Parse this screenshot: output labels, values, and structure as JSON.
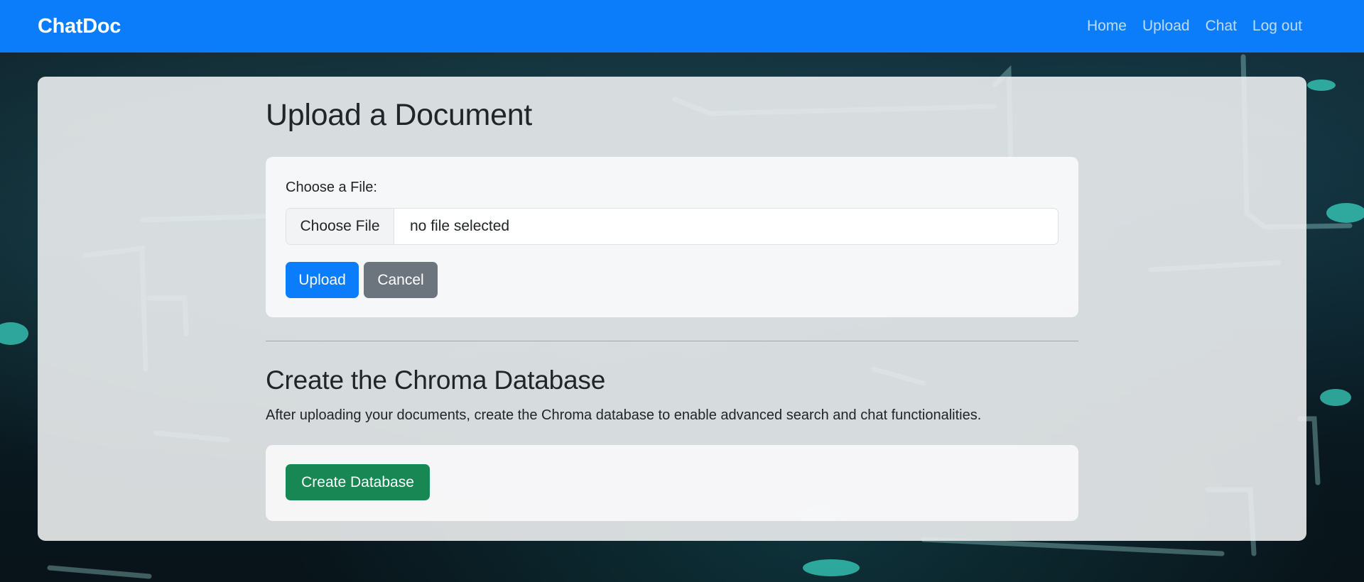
{
  "navbar": {
    "brand": "ChatDoc",
    "links": [
      "Home",
      "Upload",
      "Chat",
      "Log out"
    ]
  },
  "upload_section": {
    "title": "Upload a Document",
    "file_label": "Choose a File:",
    "file_button": "Choose File",
    "file_status": "no file selected",
    "upload_button": "Upload",
    "cancel_button": "Cancel"
  },
  "database_section": {
    "title": "Create the Chroma Database",
    "description": "After uploading your documents, create the Chroma database to enable advanced search and chat functionalities.",
    "create_button": "Create Database"
  },
  "colors": {
    "navbar": "#0b7dfa",
    "primary": "#0b7dfa",
    "secondary": "#6c757d",
    "success": "#198754"
  }
}
